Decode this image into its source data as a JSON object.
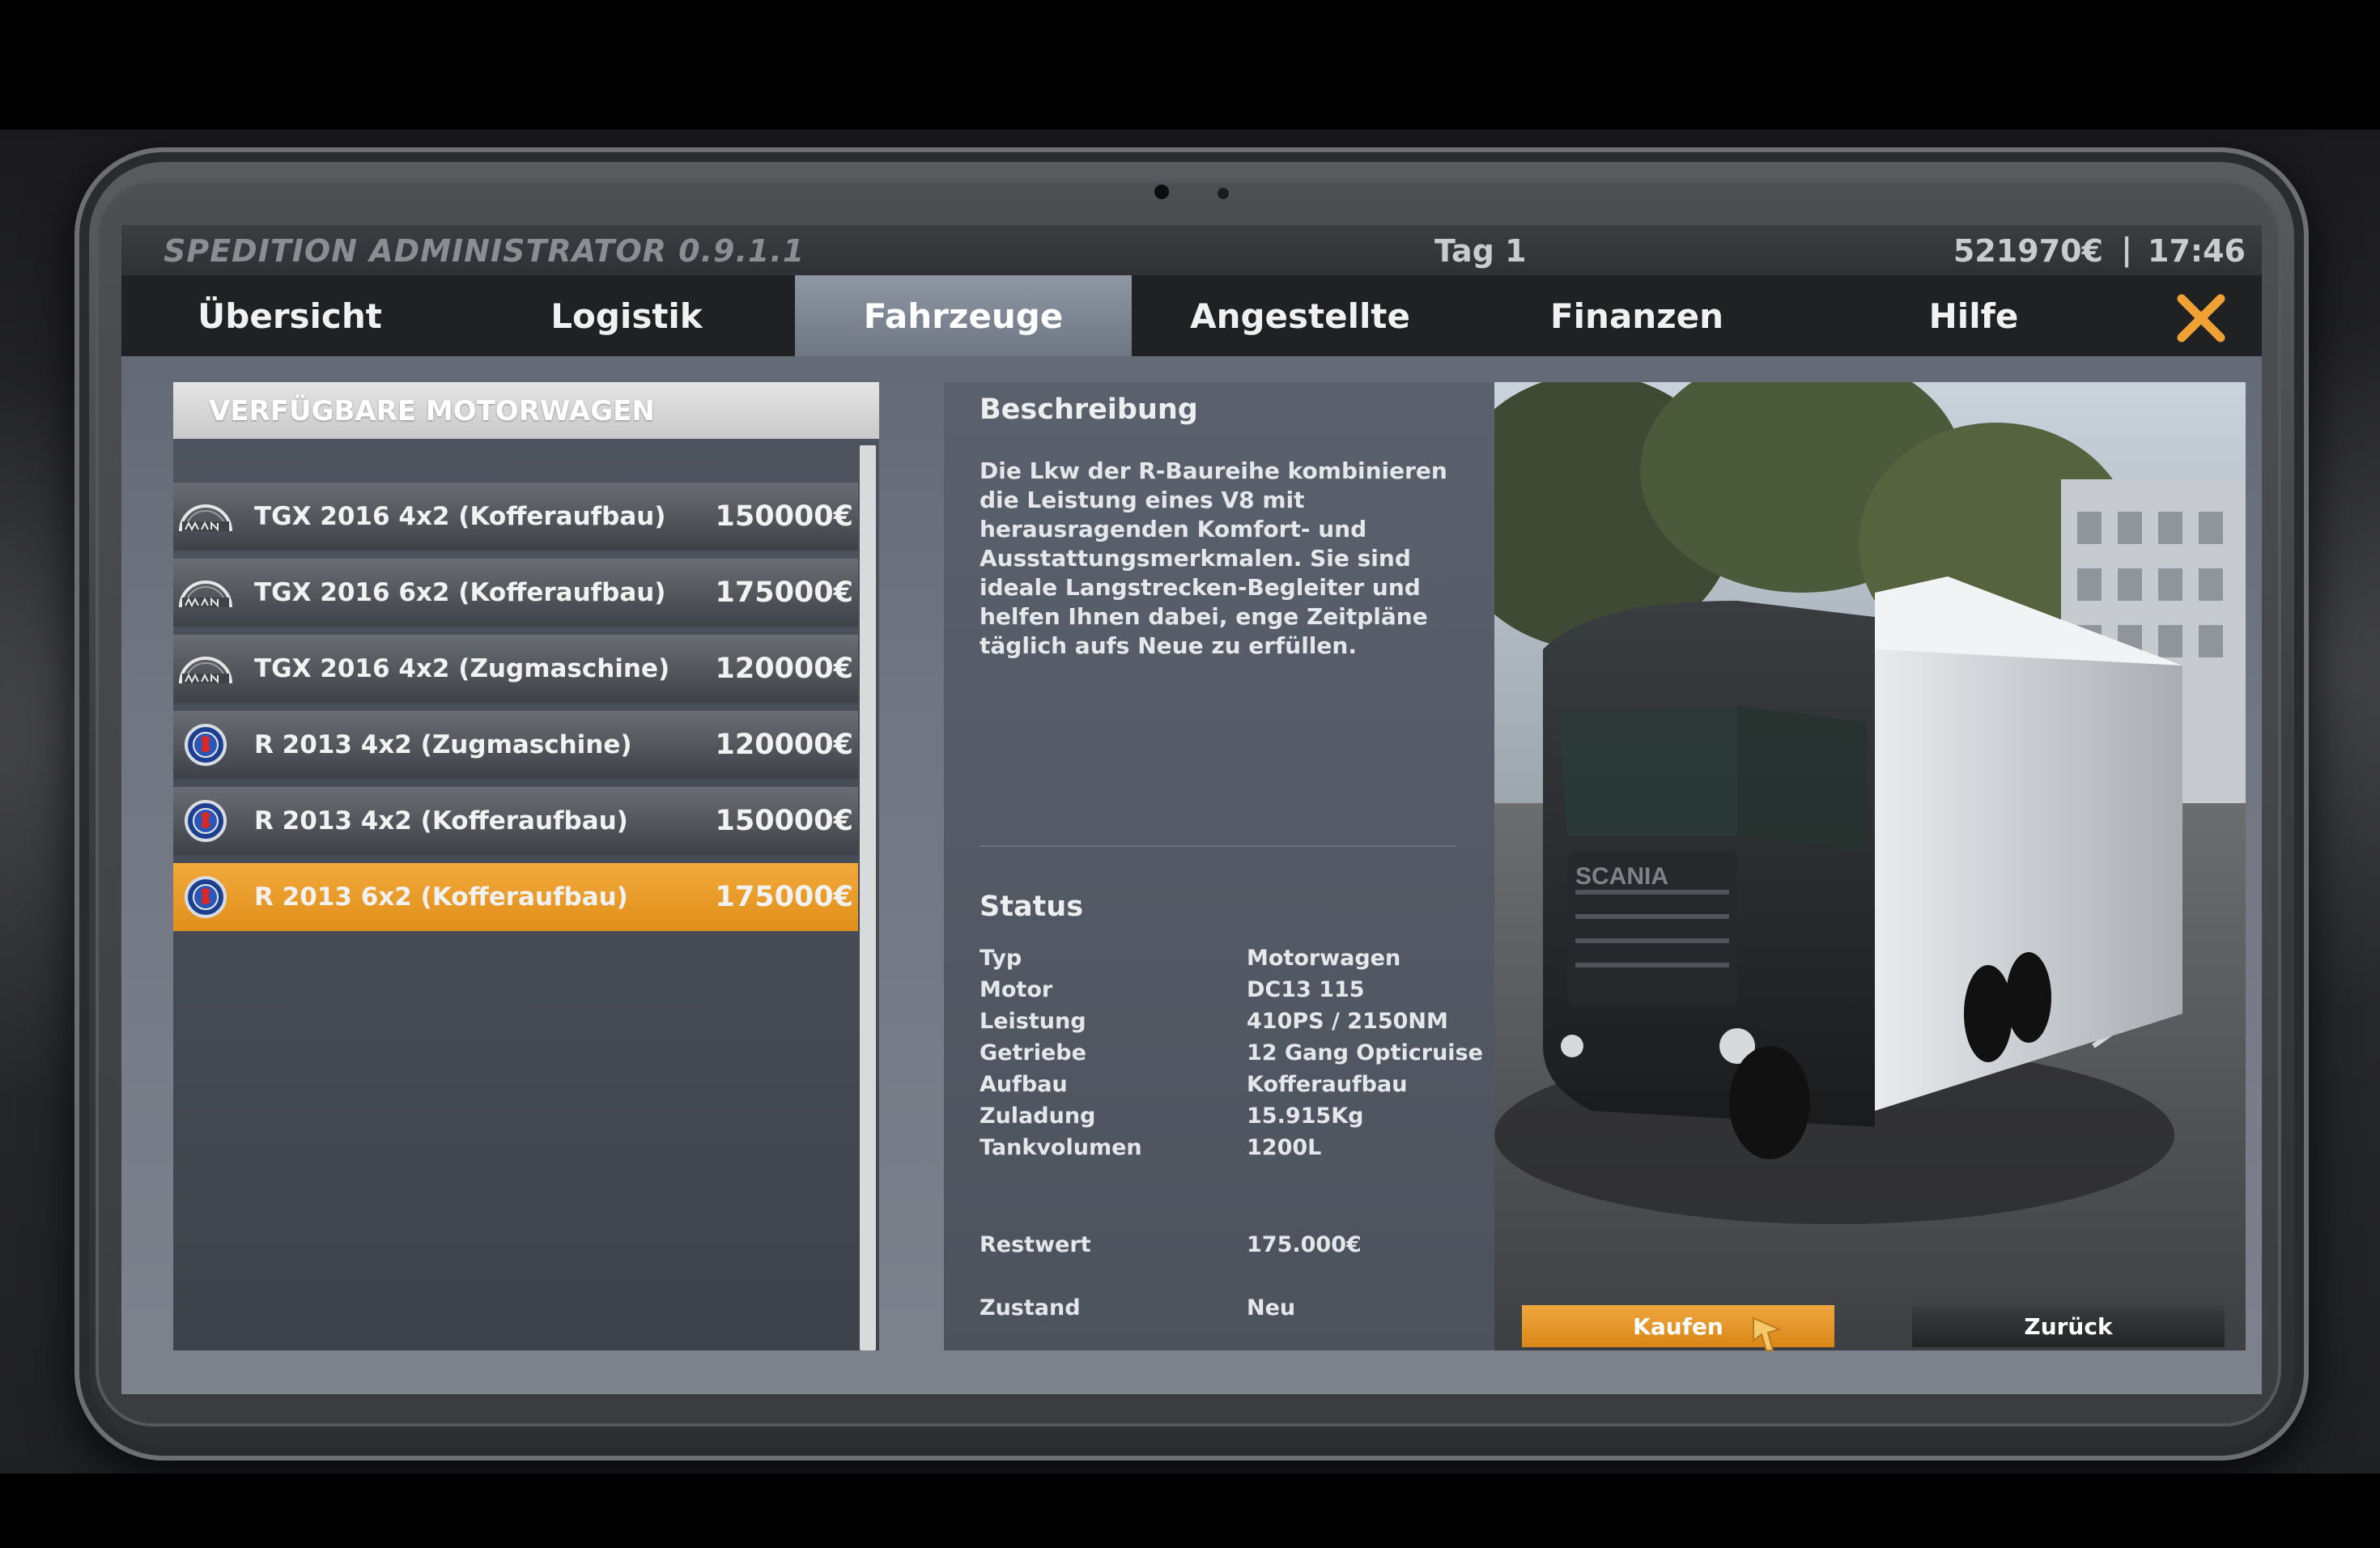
{
  "app": {
    "title": "SPEDITION ADMINISTRATOR 0.9.1.1",
    "day": "Tag 1",
    "money": "521970€",
    "separator": "|",
    "time": "17:46"
  },
  "tabs": [
    {
      "label": "Übersicht",
      "active": false
    },
    {
      "label": "Logistik",
      "active": false
    },
    {
      "label": "Fahrzeuge",
      "active": true
    },
    {
      "label": "Angestellte",
      "active": false
    },
    {
      "label": "Finanzen",
      "active": false
    },
    {
      "label": "Hilfe",
      "active": false
    }
  ],
  "close_icon": "close-x-icon",
  "accent_color": "#f0a133",
  "vehicle_list": {
    "header": "VERFÜGBARE MOTORWAGEN",
    "items": [
      {
        "brand": "man-logo-icon",
        "name": "TGX 2016 4x2 (Kofferaufbau)",
        "price": "150000€",
        "selected": false
      },
      {
        "brand": "man-logo-icon",
        "name": "TGX 2016 6x2 (Kofferaufbau)",
        "price": "175000€",
        "selected": false
      },
      {
        "brand": "man-logo-icon",
        "name": "TGX 2016 4x2 (Zugmaschine)",
        "price": "120000€",
        "selected": false
      },
      {
        "brand": "scania-logo-icon",
        "name": "R 2013 4x2 (Zugmaschine)",
        "price": "120000€",
        "selected": false
      },
      {
        "brand": "scania-logo-icon",
        "name": "R 2013 4x2 (Kofferaufbau)",
        "price": "150000€",
        "selected": false
      },
      {
        "brand": "scania-logo-icon",
        "name": "R 2013 6x2 (Kofferaufbau)",
        "price": "175000€",
        "selected": true
      }
    ]
  },
  "description": {
    "heading": "Beschreibung",
    "text": "Die Lkw der R-Baureihe kombinieren die Leistung eines V8 mit herausragenden Komfort- und Ausstattungsmerkmalen. Sie sind ideale Langstrecken-Begleiter und helfen Ihnen dabei, enge Zeitpläne täglich aufs Neue zu erfüllen."
  },
  "status": {
    "heading": "Status",
    "rows": [
      {
        "label": "Typ",
        "value": "Motorwagen"
      },
      {
        "label": "Motor",
        "value": "DC13 115"
      },
      {
        "label": "Leistung",
        "value": "410PS / 2150NM"
      },
      {
        "label": "Getriebe",
        "value": "12 Gang Opticruise"
      },
      {
        "label": "Aufbau",
        "value": "Kofferaufbau"
      },
      {
        "label": "Zuladung",
        "value": "15.915Kg"
      },
      {
        "label": "Tankvolumen",
        "value": "1200L"
      }
    ],
    "residual_label": "Restwert",
    "residual_value": "175.000€",
    "condition_label": "Zustand",
    "condition_value": "Neu"
  },
  "preview": {
    "truck_logo_text": "SCANIA"
  },
  "actions": {
    "buy_label": "Kaufen",
    "back_label": "Zurück"
  }
}
